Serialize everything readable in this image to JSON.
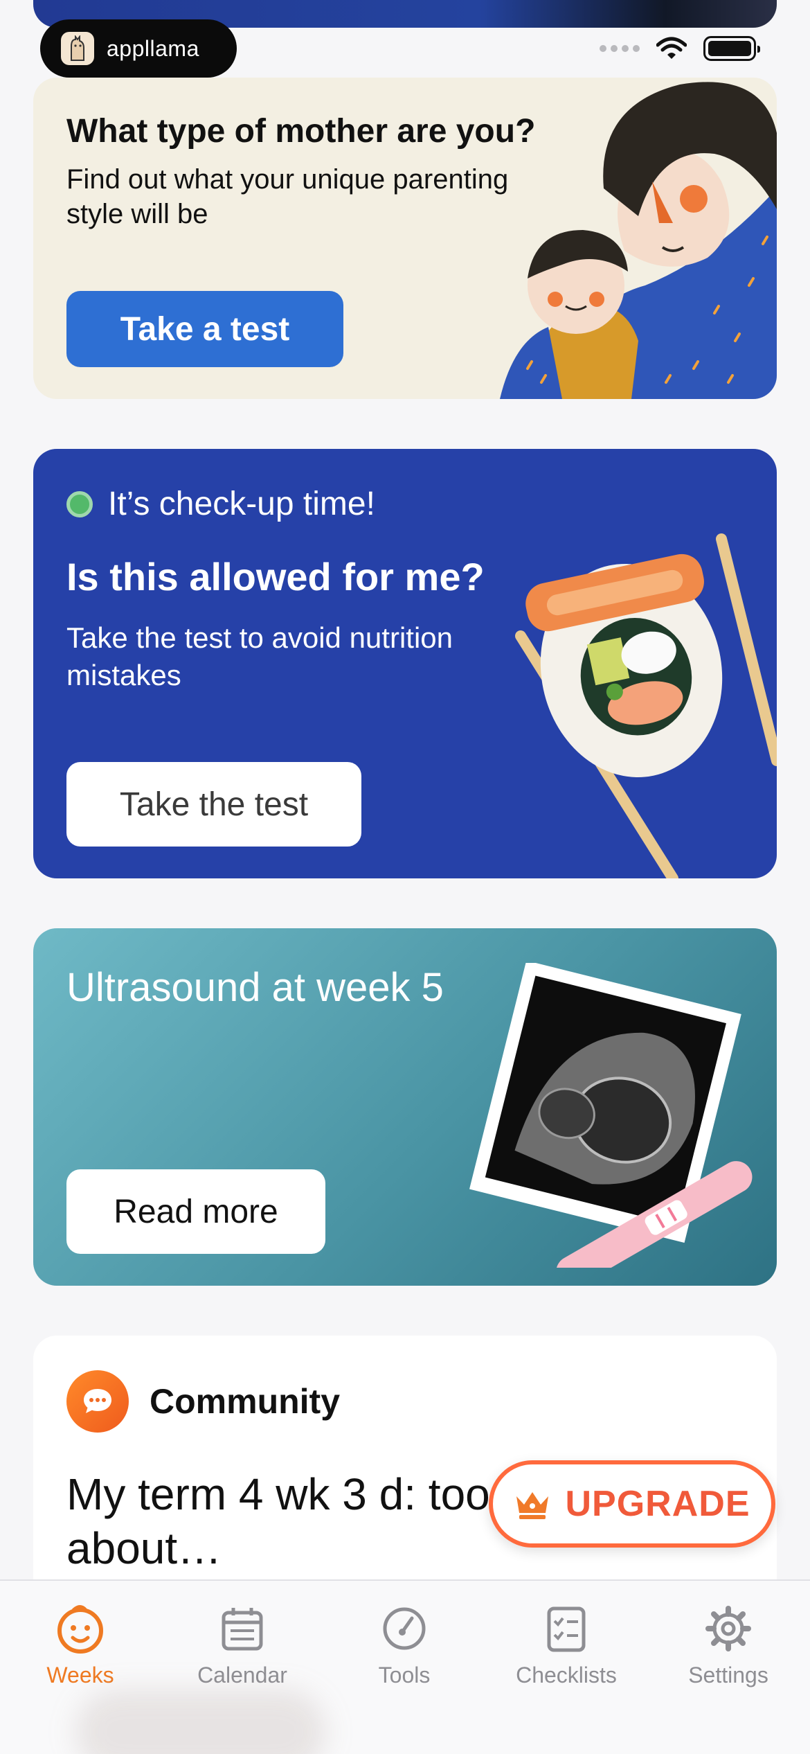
{
  "status": {
    "brand": "appllama"
  },
  "cards": {
    "mother": {
      "title": "What type of mother are you?",
      "subtitle": "Find out what your unique parenting style will be",
      "button": "Take a test"
    },
    "checkup": {
      "tag": "It’s check-up time!",
      "title": "Is this allowed for me?",
      "subtitle": "Take the test to avoid nutrition mistakes",
      "button": "Take the test"
    },
    "ultrasound": {
      "title": "Ultrasound at week 5",
      "button": "Read more"
    },
    "community": {
      "label": "Community",
      "title": "My term 4 wk 3 d: too concerned about…"
    }
  },
  "upgrade": {
    "label": "UPGRADE"
  },
  "tabbar": {
    "items": [
      {
        "label": "Weeks",
        "icon": "baby-face-icon",
        "active": true
      },
      {
        "label": "Calendar",
        "icon": "calendar-icon",
        "active": false
      },
      {
        "label": "Tools",
        "icon": "gauge-icon",
        "active": false
      },
      {
        "label": "Checklists",
        "icon": "checklist-icon",
        "active": false
      },
      {
        "label": "Settings",
        "icon": "gear-icon",
        "active": false
      }
    ]
  },
  "colors": {
    "accent": "#ef7a22",
    "primary_blue": "#2e6fd3",
    "checkup_bg": "#2641a8",
    "upgrade": "#f05a3a"
  }
}
